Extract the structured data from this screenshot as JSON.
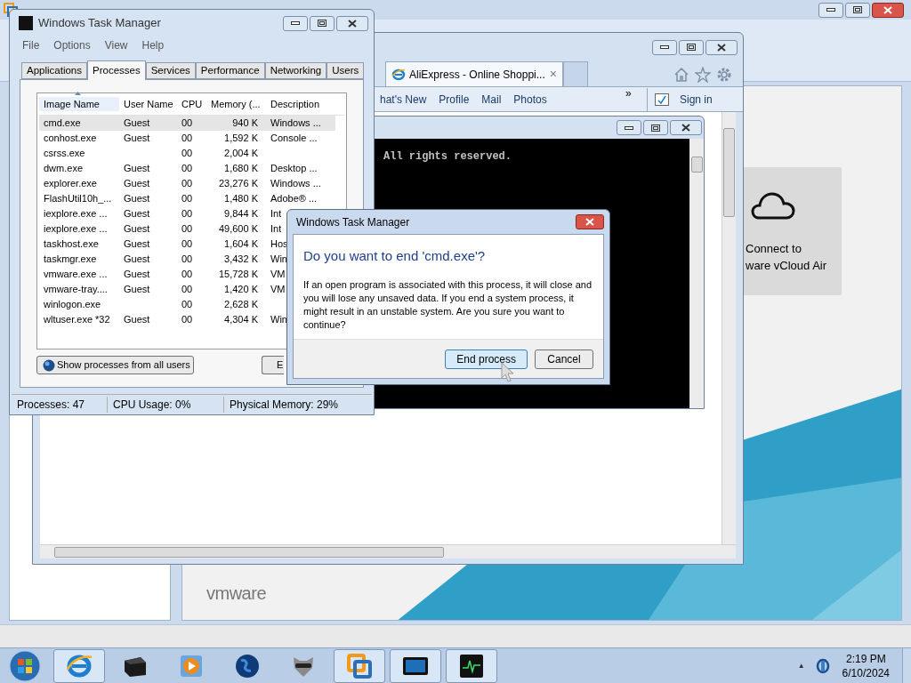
{
  "vmware": {
    "cloud_card": [
      "Connect to",
      "ware vCloud Air"
    ],
    "logo": "vmware"
  },
  "browser": {
    "tab": {
      "title": "AliExpress - Online Shoppi...",
      "close": "×"
    },
    "favorites": [
      "hat's New",
      "Profile",
      "Mail",
      "Photos"
    ],
    "more": "»",
    "sign_in": "Sign in"
  },
  "console": {
    "lines": [
      "All rights reserved."
    ]
  },
  "task_manager": {
    "title": "Windows Task Manager",
    "menu": [
      "File",
      "Options",
      "View",
      "Help"
    ],
    "tabs": [
      {
        "label": "Applications",
        "selected": false
      },
      {
        "label": "Processes",
        "selected": true
      },
      {
        "label": "Services",
        "selected": false
      },
      {
        "label": "Performance",
        "selected": false
      },
      {
        "label": "Networking",
        "selected": false
      },
      {
        "label": "Users",
        "selected": false
      }
    ],
    "columns": [
      "Image Name",
      "User Name",
      "CPU",
      "Memory (...",
      "Description"
    ],
    "rows": [
      {
        "image": "cmd.exe",
        "user": "Guest",
        "cpu": "00",
        "memory": "940 K",
        "description": "Windows ...",
        "selected": true
      },
      {
        "image": "conhost.exe",
        "user": "Guest",
        "cpu": "00",
        "memory": "1,592 K",
        "description": "Console ...",
        "selected": false
      },
      {
        "image": "csrss.exe",
        "cpu": "00",
        "memory": "2,004 K",
        "selected": false
      },
      {
        "image": "dwm.exe",
        "user": "Guest",
        "cpu": "00",
        "memory": "1,680 K",
        "description": "Desktop ...",
        "selected": false
      },
      {
        "image": "explorer.exe",
        "user": "Guest",
        "cpu": "00",
        "memory": "23,276 K",
        "description": "Windows ...",
        "selected": false
      },
      {
        "image": "FlashUtil10h_...",
        "user": "Guest",
        "cpu": "00",
        "memory": "1,480 K",
        "description": "Adobe® ...",
        "selected": false
      },
      {
        "image": "iexplore.exe ...",
        "user": "Guest",
        "cpu": "00",
        "memory": "9,844 K",
        "description": "Int",
        "selected": false
      },
      {
        "image": "iexplore.exe ...",
        "user": "Guest",
        "cpu": "00",
        "memory": "49,600 K",
        "description": "Int",
        "selected": false
      },
      {
        "image": "taskhost.exe",
        "user": "Guest",
        "cpu": "00",
        "memory": "1,604 K",
        "description": "Hos",
        "selected": false
      },
      {
        "image": "taskmgr.exe",
        "user": "Guest",
        "cpu": "00",
        "memory": "3,432 K",
        "description": "Win",
        "selected": false
      },
      {
        "image": "vmware.exe ...",
        "user": "Guest",
        "cpu": "00",
        "memory": "15,728 K",
        "description": "VM",
        "selected": false
      },
      {
        "image": "vmware-tray....",
        "user": "Guest",
        "cpu": "00",
        "memory": "1,420 K",
        "description": "VM",
        "selected": false
      },
      {
        "image": "winlogon.exe",
        "cpu": "00",
        "memory": "2,628 K",
        "selected": false
      },
      {
        "image": "wltuser.exe *32",
        "user": "Guest",
        "cpu": "00",
        "memory": "4,304 K",
        "description": "Win",
        "selected": false
      }
    ],
    "show_all_button": "Show processes from all users",
    "end_button": "E",
    "status": [
      "Processes: 47",
      "CPU Usage: 0%",
      "Physical Memory: 29%"
    ]
  },
  "dialog": {
    "title": "Windows Task Manager",
    "heading": "Do you want to end 'cmd.exe'?",
    "message": "If an open program is associated with this process, it will close and you will lose any unsaved data. If you end a system process, it might result in an unstable system. Are you sure you want to continue?",
    "buttons": [
      {
        "label": "End process",
        "selected": true
      },
      {
        "label": "Cancel",
        "selected": false
      }
    ]
  },
  "taskbar": {
    "apps": [
      {
        "open": true
      },
      {
        "open": false
      },
      {
        "open": false
      },
      {
        "open": false
      },
      {
        "open": false
      },
      {
        "open": true
      },
      {
        "open": true
      },
      {
        "open": true
      }
    ],
    "tray_arrow": "▲",
    "time": "2:19 PM",
    "date": "6/10/2024"
  }
}
